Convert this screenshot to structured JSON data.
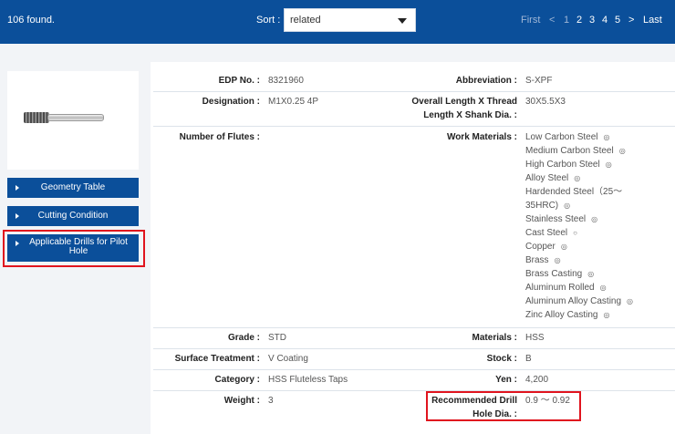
{
  "header": {
    "found": "106 found.",
    "sort_label": "Sort :",
    "sort_value": "related",
    "pager": {
      "first": "First",
      "prev": "<",
      "pages": [
        "1",
        "2",
        "3",
        "4",
        "5"
      ],
      "next": ">",
      "last": "Last"
    }
  },
  "sidebar": {
    "buttons": [
      "Geometry Table",
      "Cutting Condition",
      "Applicable Drills for Pilot Hole"
    ]
  },
  "specs": {
    "edp_label": "EDP No. :",
    "edp": "8321960",
    "abbr_label": "Abbreviation :",
    "abbr": "S-XPF",
    "designation_label": "Designation :",
    "designation": "M1X0.25 4P",
    "overall_label_1": "Overall Length X Thread",
    "overall_label_2": "Length X Shank Dia. :",
    "overall": "30X5.5X3",
    "flutes_label": "Number of Flutes :",
    "work_label": "Work Materials :",
    "grade_label": "Grade :",
    "grade": "STD",
    "materials_label": "Materials :",
    "materials": "HSS",
    "surface_label": "Surface Treatment :",
    "surface": "V Coating",
    "stock_label": "Stock :",
    "stock": "B",
    "category_label": "Category :",
    "category": "HSS Fluteless Taps",
    "yen_label": "Yen :",
    "yen": "4,200",
    "weight_label": "Weight :",
    "weight": "3",
    "drill_label_1": "Recommended Drill",
    "drill_label_2": "Hole Dia. :",
    "drill": "0.9 ～ 0.92"
  },
  "work_materials": [
    {
      "name": "Low Carbon Steel",
      "mark": "◎"
    },
    {
      "name": "Medium Carbon Steel",
      "mark": "◎"
    },
    {
      "name": "High Carbon Steel",
      "mark": "◎"
    },
    {
      "name": "Alloy Steel",
      "mark": "◎"
    },
    {
      "name": "Hardended Steel（25～",
      "mark": ""
    },
    {
      "name": "35HRC)",
      "mark": "◎"
    },
    {
      "name": "Stainless Steel",
      "mark": "◎"
    },
    {
      "name": "Cast Steel",
      "mark": "○"
    },
    {
      "name": "Copper",
      "mark": "◎"
    },
    {
      "name": "Brass",
      "mark": "◎"
    },
    {
      "name": "Brass Casting",
      "mark": "◎"
    },
    {
      "name": "Aluminum Rolled",
      "mark": "◎"
    },
    {
      "name": "Aluminum Alloy Casting",
      "mark": "◎"
    },
    {
      "name": "Zinc Alloy Casting",
      "mark": "◎"
    }
  ],
  "colors": {
    "brand": "#0b4f9a",
    "highlight": "#e0141e"
  }
}
